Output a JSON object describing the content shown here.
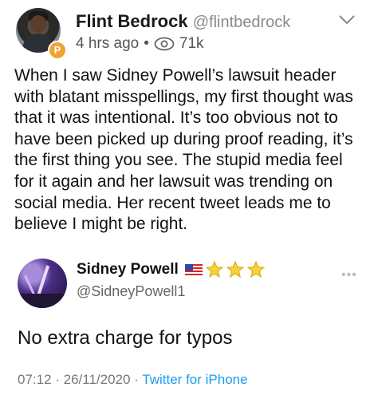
{
  "author": {
    "name": "Flint Bedrock",
    "handle": "@flintbedrock",
    "time": "4 hrs ago",
    "separator": "•",
    "views": "71k",
    "badge_letter": "P",
    "badge_color": "#f0a431"
  },
  "post": {
    "text": "When I saw Sidney Powell’s lawsuit header with blatant misspellings, my first thought was that it was intentional. It’s too obvious not to have been picked up during proof reading, it’s the first thing you see. The stupid media feel for it again and her lawsuit was trending on social media. Her recent tweet leads me to believe I might be right."
  },
  "quoted": {
    "name": "Sidney Powell",
    "handle": "@SidneyPowell1",
    "more": "•••",
    "text": "No extra charge for typos",
    "time_date": "07:12 · 26/11/2020 · ",
    "source": "Twitter for iPhone",
    "link_color": "#1d9bf0"
  }
}
